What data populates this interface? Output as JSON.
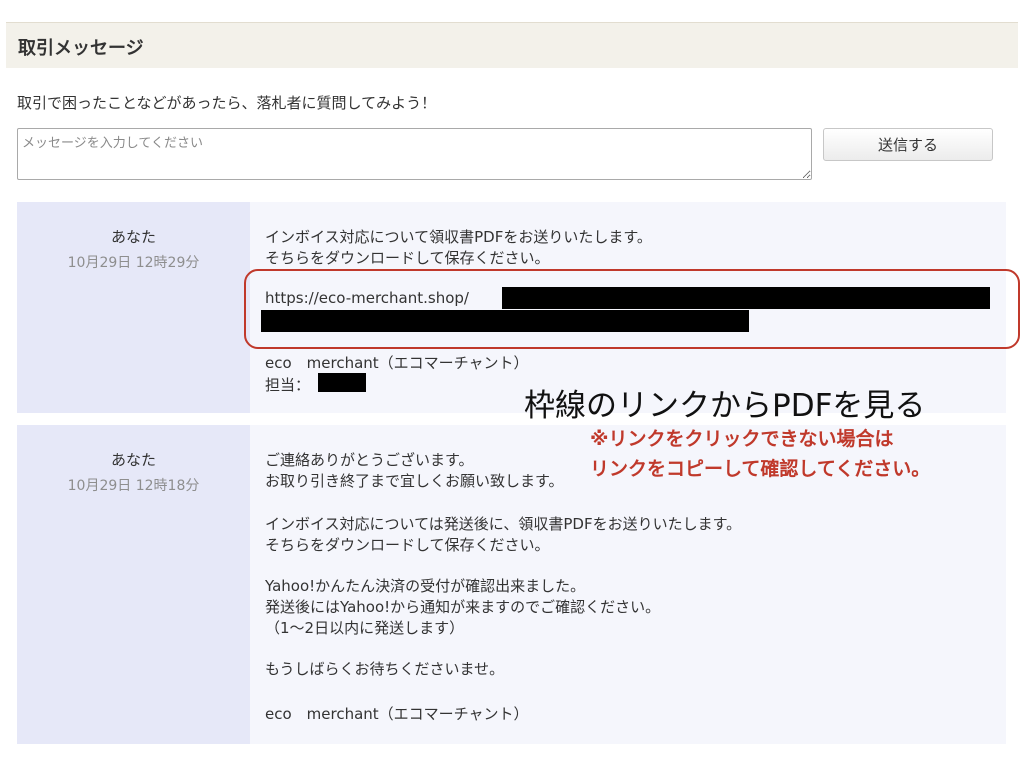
{
  "section_title": "取引メッセージ",
  "intro_text": "取引で困ったことなどがあったら、落札者に質問してみよう！",
  "message_input": {
    "placeholder": "メッセージを入力してください",
    "value": ""
  },
  "send_button": "送信する",
  "messages": [
    {
      "sender": "あなた",
      "timestamp": "10月29日 12時29分",
      "lines": [
        "インボイス対応について領収書PDFをお送りいたします。",
        "そちらをダウンロードして保存ください。",
        "https://eco-merchant.shop/",
        "eco　merchant（エコマーチャント）",
        "担当："
      ]
    },
    {
      "sender": "あなた",
      "timestamp": "10月29日 12時18分",
      "lines": [
        "ご連絡ありがとうございます。",
        "お取り引き終了まで宜しくお願い致します。",
        "インボイス対応については発送後に、領収書PDFをお送りいたします。",
        "そちらをダウンロードして保存ください。",
        "Yahoo!かんたん決済の受付が確認出来ました。",
        "発送後にはYahoo!から通知が来ますのでご確認ください。",
        "（1〜2日以内に発送します）",
        "もうしばらくお待ちくださいませ。",
        "eco　merchant（エコマーチャント）"
      ]
    }
  ],
  "annotation": {
    "main": "枠線のリンクからPDFを見る",
    "note_line1": "※リンクをクリックできない場合は",
    "note_line2": "リンクをコピーして確認してください。",
    "color": "#c0392b"
  }
}
